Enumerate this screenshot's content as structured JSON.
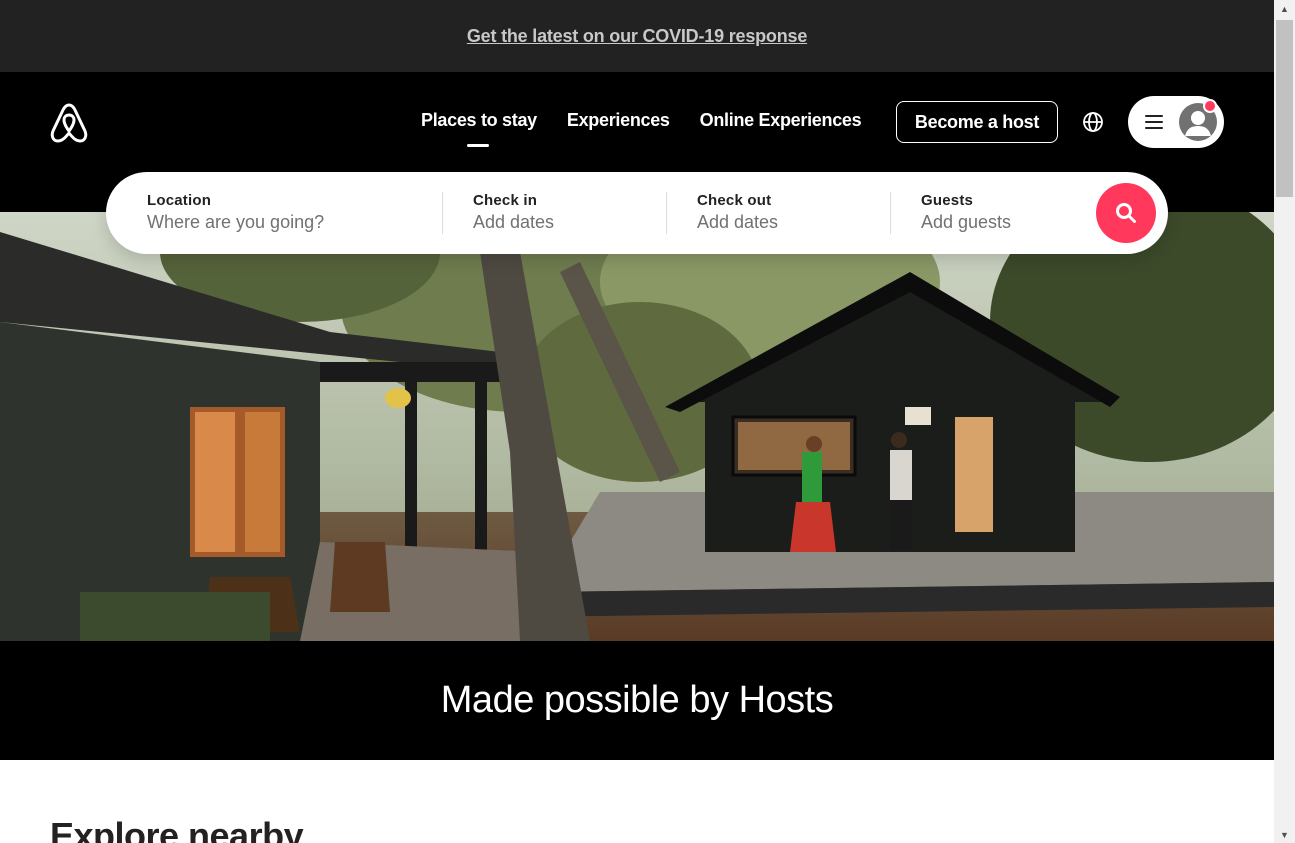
{
  "banner": {
    "link_text": "Get the latest on our COVID-19 response"
  },
  "header": {
    "logo_icon": "airbnb-logo-icon",
    "nav": [
      {
        "label": "Places to stay",
        "active": true
      },
      {
        "label": "Experiences",
        "active": false
      },
      {
        "label": "Online Experiences",
        "active": false
      }
    ],
    "host_button": "Become a host",
    "globe_icon": "globe-icon",
    "menu_icon": "hamburger-menu-icon",
    "avatar_icon": "user-avatar-icon"
  },
  "search": {
    "location": {
      "label": "Location",
      "placeholder": "Where are you going?"
    },
    "check_in": {
      "label": "Check in",
      "placeholder": "Add dates"
    },
    "check_out": {
      "label": "Check out",
      "placeholder": "Add dates"
    },
    "guests": {
      "label": "Guests",
      "placeholder": "Add guests"
    },
    "button_icon": "search-icon"
  },
  "hero": {
    "tagline": "Made possible by Hosts"
  },
  "explore": {
    "heading": "Explore nearby"
  },
  "colors": {
    "brand": "#ff385c",
    "banner_bg": "#222222",
    "header_bg": "#000000"
  }
}
